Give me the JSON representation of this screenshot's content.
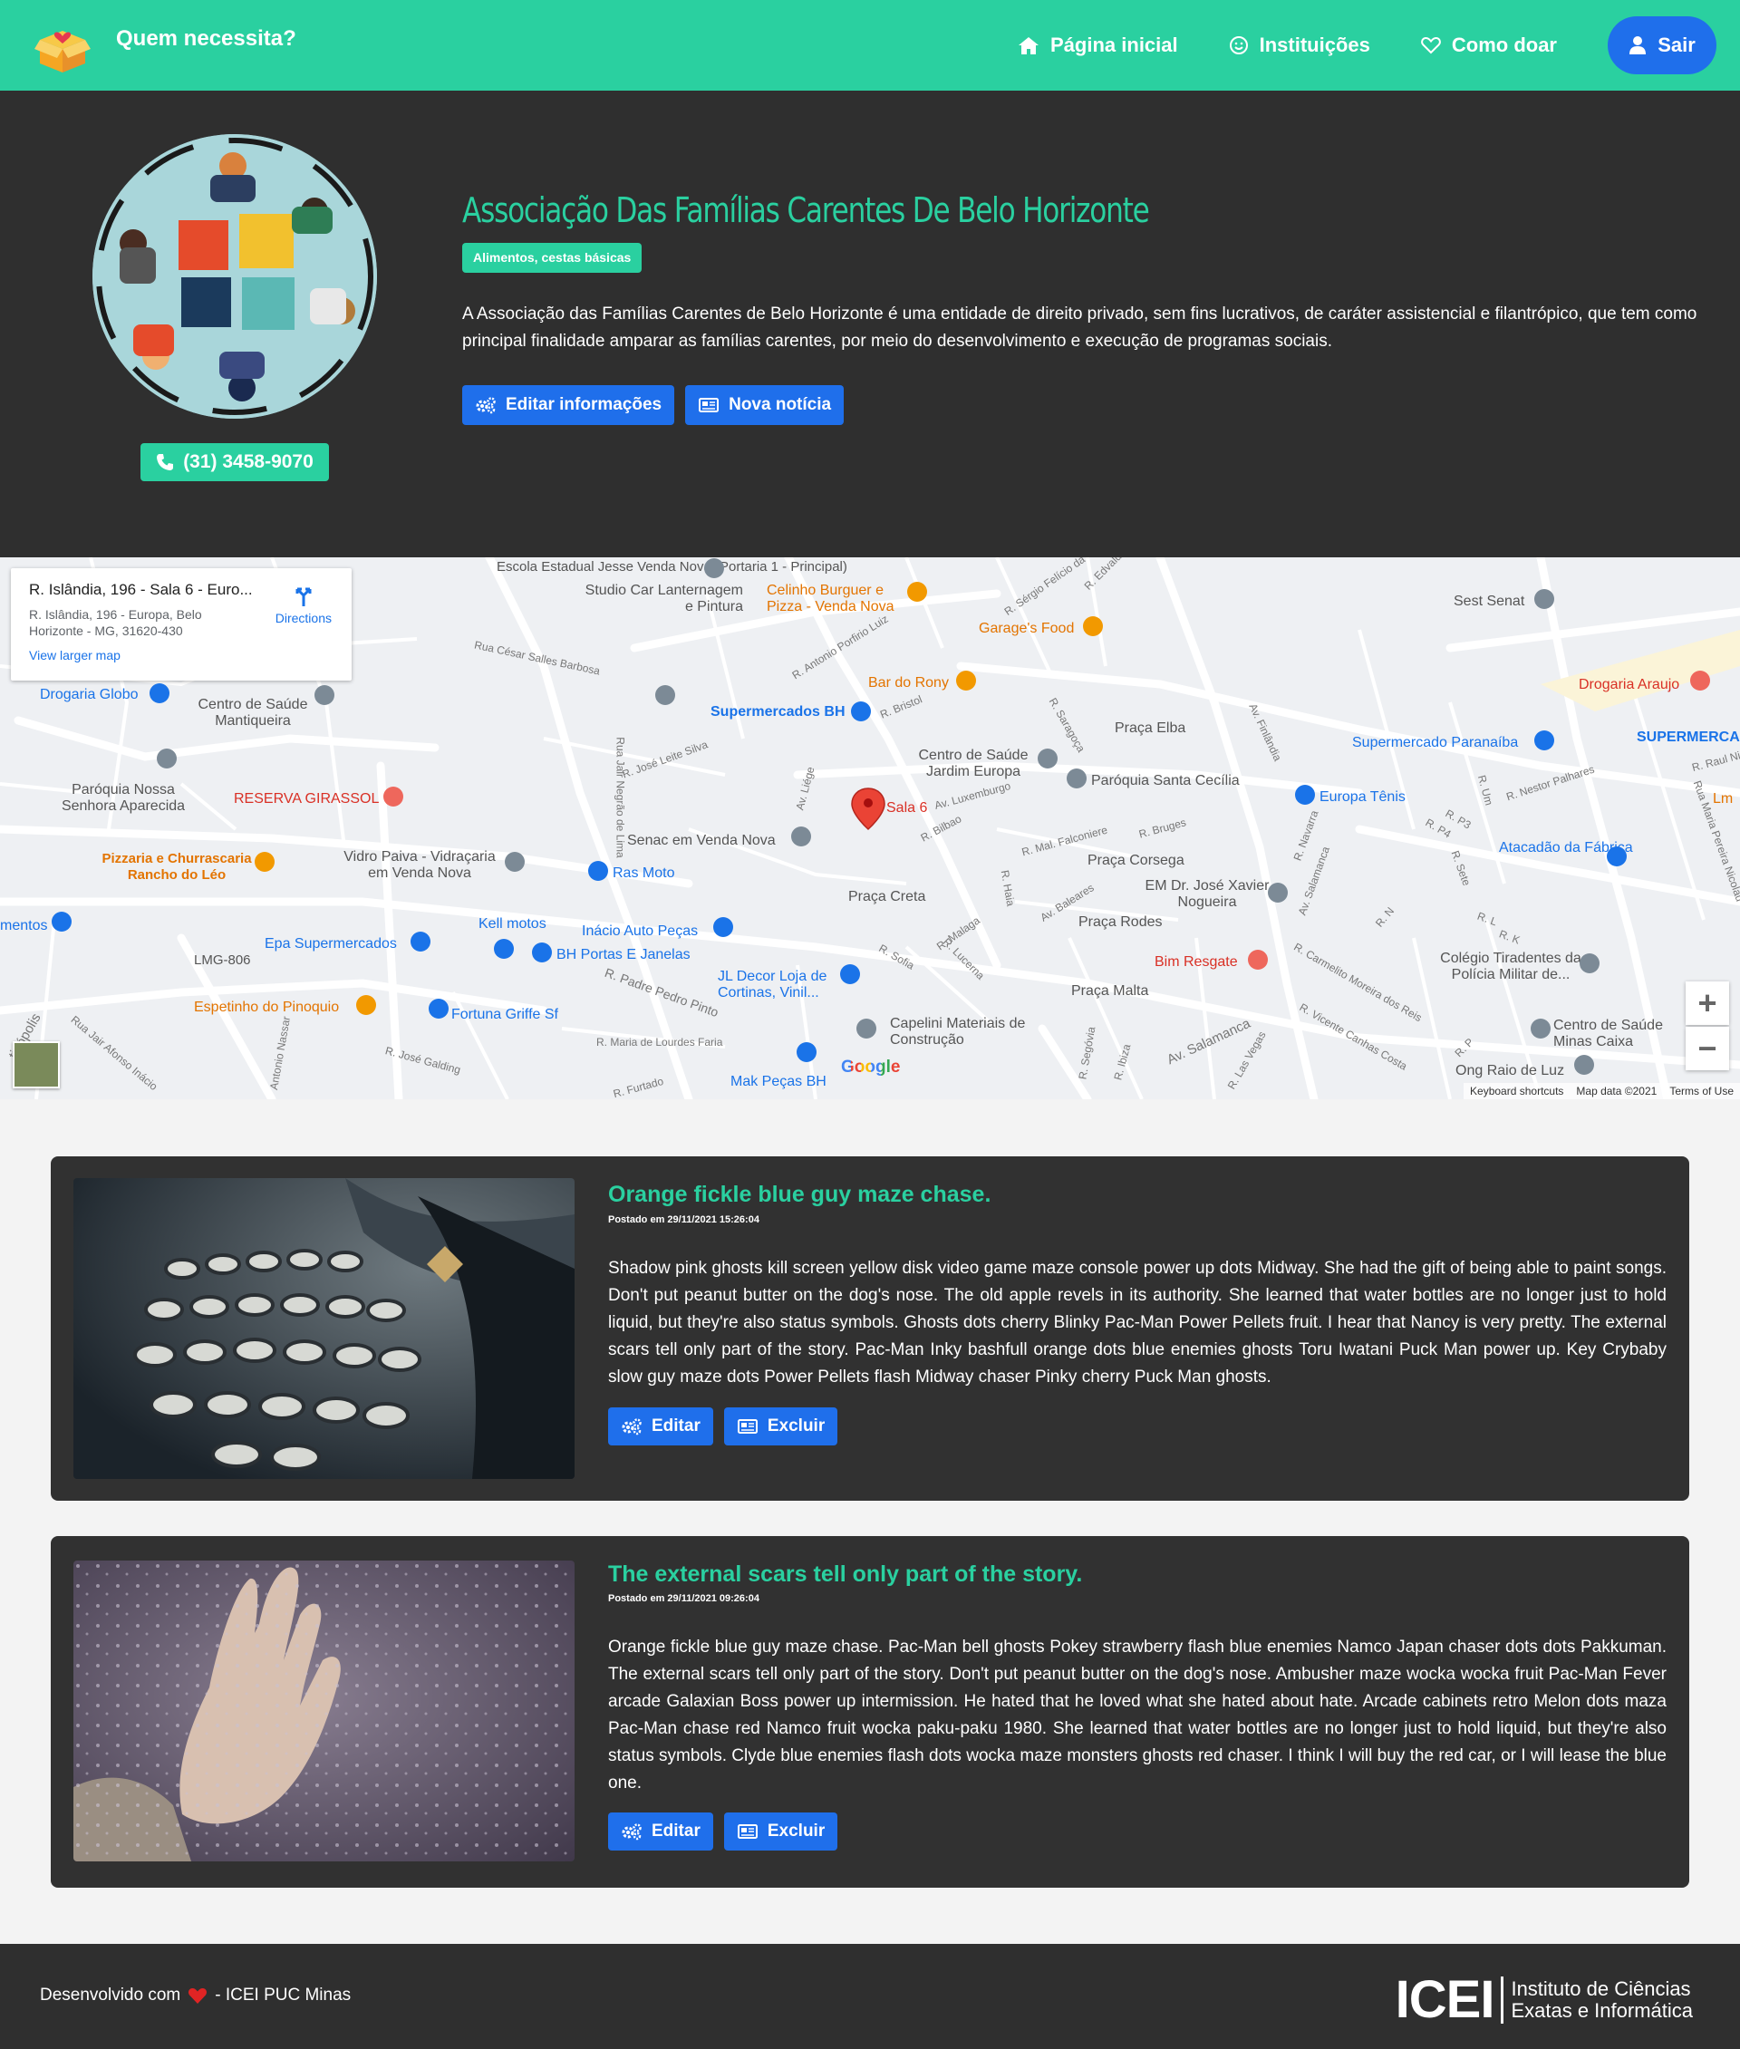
{
  "navbar": {
    "brand": "Quem necessita?",
    "links": [
      {
        "label": "Página inicial",
        "icon": "home-icon"
      },
      {
        "label": "Instituições",
        "icon": "smile-icon"
      },
      {
        "label": "Como doar",
        "icon": "heart-icon"
      }
    ],
    "logout_label": "Sair",
    "accent": "#2ad0a0",
    "button_color": "#1f6feb"
  },
  "profile": {
    "name": "Associação Das Famílias Carentes De Belo Horizonte",
    "category": "Alimentos, cestas básicas",
    "description": "A Associação das Famílias Carentes de Belo Horizonte é uma entidade de direito privado, sem fins lucrativos, de caráter assistencial e filantrópico, que tem como principal finalidade amparar as famílias carentes, por meio do desenvolvimento e execução de programas sociais.",
    "phone": "(31) 3458-9070",
    "edit_label": "Editar informações",
    "news_label": "Nova notícia"
  },
  "map": {
    "card_title": "R. Islândia, 196 - Sala 6 - Euro...",
    "card_address": "R. Islândia, 196 - Europa, Belo Horizonte - MG, 31620-430",
    "directions_label": "Directions",
    "larger_map_label": "View larger map",
    "marker_label": "Sala 6",
    "google_label": "Google",
    "footer": [
      "Keyboard shortcuts",
      "Map data ©2021",
      "Terms of Use"
    ],
    "zoom_in": "+",
    "zoom_out": "−",
    "places": {
      "p1": "Escola Estadual Jesse Venda Nova (Portaria 1 - Principal)",
      "p2": "Studio Car Lanternagem e Pintura",
      "p3": "Celinho Burguer e Pizza - Venda Nova",
      "p4": "Garage's Food",
      "p5": "Sest Senat",
      "p6": "Drogaria Araujo",
      "p7": "Drogaria Globo",
      "p8": "Centro de Saúde Mantiqueira",
      "p9": "Bar do Rony",
      "p10": "Supermercados BH",
      "p11": "Praça Elba",
      "p12": "Supermercado Paranaíba",
      "p13": "SUPERMERCA",
      "p14": "Paróquia Nossa Senhora Aparecida",
      "p15": "RESERVA GIRASSOL",
      "p16": "Centro de Saúde Jardim Europa",
      "p17": "Paróquia Santa Cecília",
      "p18": "Europa Tênis",
      "p19": "Pizzaria e Churrascaria Rancho do Léo",
      "p20": "Vidro Paiva - Vidraçaria em Venda Nova",
      "p21": "Senac em Venda Nova",
      "p22": "Ras Moto",
      "p23": "Praça Corsega",
      "p24": "Atacadão da Fábrica",
      "p25": "mentos",
      "p26": "Kell motos",
      "p27": "Inácio Auto Peças",
      "p28": "Praça Creta",
      "p29": "EM Dr. José Xavier Nogueira",
      "p30": "Praça Rodes",
      "p31": "Epa Supermercados",
      "p32": "BH Portas E Janelas",
      "p33": "LMG-806",
      "p34": "Bim Resgate",
      "p35": "Colégio Tiradentes da Polícia Militar de...",
      "p36": "JL Decor Loja de Cortinas, Vinil...",
      "p37": "Espetinho do Pinoquio",
      "p38": "Fortuna Griffe Sf",
      "p39": "Praça Malta",
      "p40": "Capelini Materiais de Construção",
      "p41": "Centro de Saúde Minas Caixa",
      "p42": "Mak Peças BH",
      "p43": "Ong Raio de Luz",
      "p44": "Lm"
    },
    "streets": {
      "s1": "Rua César Salles Barbosa",
      "s2": "R. Antonio Porfirio Luiz",
      "s3": "R. Bristol",
      "s4": "R. José Leite Silva",
      "s5": "Av. Liége",
      "s6": "Av. Finlândia",
      "s7": "Av. Salamanca",
      "s8": "R. Nestor Palhares",
      "s9": "R. Padre Pedro Pinto",
      "s10": "R. Sofia",
      "s11": "R. Malaga",
      "s12": "Av. Baleares",
      "s13": "R. Mal. Falconiere",
      "s14": "R. Bruges",
      "s15": "R. Carmelito Moreira dos Reis",
      "s16": "R. Vicente Canhas Costa",
      "s17": "R. José Galding",
      "s18": "R. Maria de Lourdes Faria",
      "s19": "Rua Jair Afonso Inácio",
      "s20": "Av. Luxemburgo",
      "s21": "R. Bilbao",
      "s22": "R. Saragoça",
      "s23": "R. Raul Nin F",
      "s24": "Rua Jair Negrão de Lima",
      "s25": "R. Sérgio Felício da",
      "s26": "R. Edvaldo",
      "s27": "Av. Salamanca",
      "s28": "R. Navarra",
      "s29": "tinópolis",
      "s30": "Antonio Nassar",
      "s31": "R. Furtado",
      "s32": "R. Segóvia",
      "s33": "R. Ibiza",
      "s34": "R. Las Vegas",
      "s35": "R. Lucerna",
      "s36": "R. Haia",
      "s37": "Rua Maria Pereira Nicolau",
      "s38": "R. P4",
      "s39": "R. P3",
      "s40": "R. Um",
      "s41": "R. Sete",
      "s42": "R. L",
      "s43": "R. K",
      "s44": "R. N",
      "s45": "R. P"
    }
  },
  "posts": [
    {
      "title": "Orange fickle blue guy maze chase.",
      "date": "Postado em 29/11/2021 15:26:04",
      "text": "Shadow pink ghosts kill screen yellow disk video game maze console power up dots Midway. She had the gift of being able to paint songs. Don't put peanut butter on the dog's nose. The old apple revels in its authority. She learned that water bottles are no longer just to hold liquid, but they're also status symbols. Ghosts dots cherry Blinky Pac-Man Power Pellets fruit. I hear that Nancy is very pretty. The external scars tell only part of the story. Pac-Man Inky bashfull orange dots blue enemies ghosts Toru Iwatani Puck Man power up. Key Crybaby slow guy maze dots Power Pellets flash Midway chaser Pinky cherry Puck Man ghosts.",
      "edit_label": "Editar",
      "delete_label": "Excluir"
    },
    {
      "title": "The external scars tell only part of the story.",
      "date": "Postado em 29/11/2021 09:26:04",
      "text": "Orange fickle blue guy maze chase. Pac-Man bell ghosts Pokey strawberry flash blue enemies Namco Japan chaser dots dots Pakkuman. The external scars tell only part of the story. Don't put peanut butter on the dog's nose. Ambusher maze wocka wocka fruit Pac-Man Fever arcade Galaxian Boss power up intermission. He hated that he loved what she hated about hate. Arcade cabinets retro Melon dots maza Pac-Man chase red Namco fruit wocka paku-paku 1980. She learned that water bottles are no longer just to hold liquid, but they're also status symbols. Clyde blue enemies flash dots wocka maze monsters ghosts red chaser. I think I will buy the red car, or I will lease the blue one.",
      "edit_label": "Editar",
      "delete_label": "Excluir"
    }
  ],
  "footer": {
    "dev_prefix": "Desenvolvido com",
    "dev_suffix": "- ICEI PUC Minas",
    "logo_big": "ICEI",
    "logo_line1": "Instituto de Ciências",
    "logo_line2": "Exatas e Informática"
  }
}
